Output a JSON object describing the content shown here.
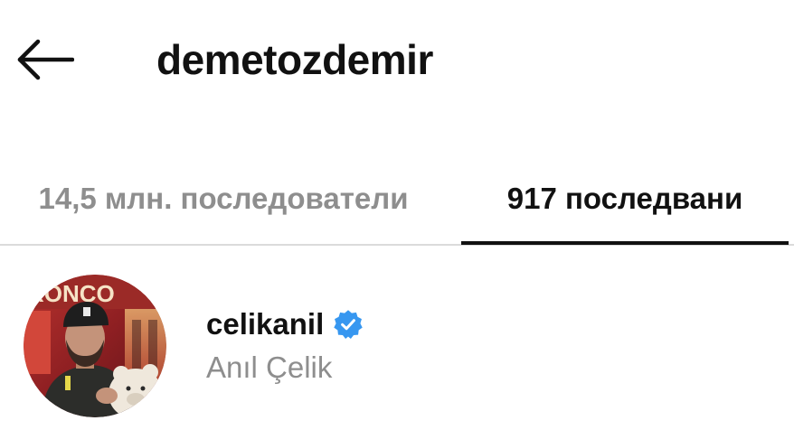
{
  "header": {
    "title": "demetozdemir",
    "back_icon": "arrow-left-icon"
  },
  "tabs": [
    {
      "label": "14,5 млн. последователи",
      "active": false
    },
    {
      "label": "917 последвани",
      "active": true
    }
  ],
  "following_list": [
    {
      "username": "celikanil",
      "full_name": "Anıl Çelik",
      "verified": true,
      "verified_icon": "verified-badge-icon",
      "verified_color": "#3797f0",
      "avatar_sign_text": "RONCO"
    }
  ],
  "colors": {
    "text_primary": "#111111",
    "text_secondary": "#8e8e8e",
    "divider": "#dbdbdb",
    "verified_blue": "#3797f0"
  }
}
